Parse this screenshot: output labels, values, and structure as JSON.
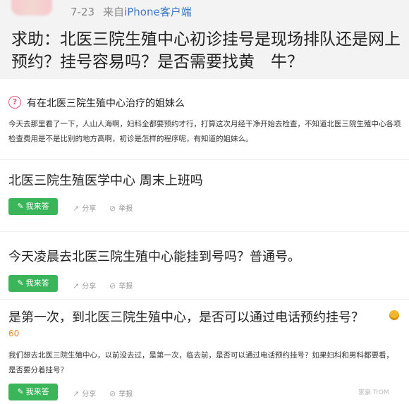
{
  "header": {
    "date": "7-23",
    "source_prefix": "来自",
    "source_client": "iPhone客户端",
    "title": "求助：北医三院生殖中心初诊挂号是现场排队还是网上预约？挂号容易吗？是否需要找黄　牛？"
  },
  "related": {
    "title": "有在北医三院生殖中心治疗的姐妹么",
    "description": "今天去那里看了一下，人山人海啊，妇科全都要预约才行，打算这次月经干净开始去检查，不知道北医三院生殖中心各项检查费用是不是比别的地方高啊，初诊是怎样的程序呢，有知道的姐妹么。"
  },
  "questions": [
    {
      "title": "北医三院生殖医学中心 周末上班吗",
      "answer_label": "我来答",
      "share_label": "分享",
      "report_label": "举报"
    },
    {
      "title": "今天凌晨去北医三院生殖中心能挂到号吗？普通号。",
      "answer_label": "我来答",
      "share_label": "分享",
      "report_label": "举报"
    },
    {
      "title": "是第一次，到北医三院生殖中心，是否可以通过电话预约挂号？",
      "reward": "60",
      "description": "我们想去北医三院生殖中心，以前没去过，是第一次，临去前，是否可以通过电话预约挂号？如果妇科和男科都要看，是否要分着挂号？",
      "answer_label": "我来答",
      "share_label": "分享",
      "report_label": "举报"
    }
  ],
  "watermark": "家豪 TrOM"
}
